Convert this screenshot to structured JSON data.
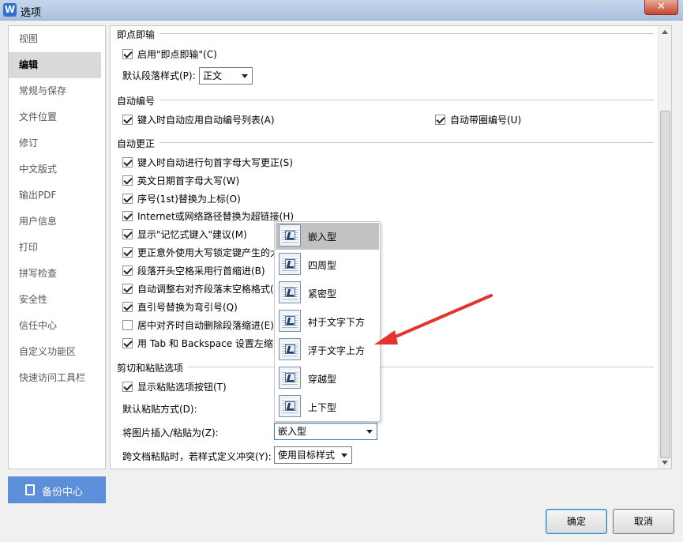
{
  "window": {
    "title": "选项",
    "app_icon": "W",
    "close_label": "✕"
  },
  "sidebar": {
    "items": [
      {
        "label": "视图"
      },
      {
        "label": "编辑"
      },
      {
        "label": "常规与保存"
      },
      {
        "label": "文件位置"
      },
      {
        "label": "修订"
      },
      {
        "label": "中文版式"
      },
      {
        "label": "输出PDF"
      },
      {
        "label": "用户信息"
      },
      {
        "label": "打印"
      },
      {
        "label": "拼写检查"
      },
      {
        "label": "安全性"
      },
      {
        "label": "信任中心"
      },
      {
        "label": "自定义功能区"
      },
      {
        "label": "快速访问工具栏"
      }
    ],
    "active_index": 1,
    "backup_label": "备份中心"
  },
  "sections": {
    "click_input": {
      "title": "即点即输",
      "enable_label": "启用\"即点即输\"(C)",
      "enable_checked": true,
      "default_style_label": "默认段落样式(P):",
      "default_style_value": "正文"
    },
    "auto_number": {
      "title": "自动编号",
      "apply_list_label": "键入时自动应用自动编号列表(A)",
      "apply_list_checked": true,
      "circled_label": "自动带圈编号(U)",
      "circled_checked": true
    },
    "auto_correct": {
      "title": "自动更正",
      "items": [
        {
          "label": "键入时自动进行句首字母大写更正(S)",
          "checked": true
        },
        {
          "label": "英文日期首字母大写(W)",
          "checked": true
        },
        {
          "label": "序号(1st)替换为上标(O)",
          "checked": true
        },
        {
          "label": "Internet或网络路径替换为超链接(H)",
          "checked": true
        },
        {
          "label": "显示\"记忆式键入\"建议(M)",
          "checked": true
        },
        {
          "label": "更正意外使用大写锁定键产生的大",
          "checked": true
        },
        {
          "label": "段落开头空格采用行首缩进(B)",
          "checked": true
        },
        {
          "label": "自动调整右对齐段落末空格格式(",
          "checked": true
        },
        {
          "label": "直引号替换为弯引号(Q)",
          "checked": true
        },
        {
          "label": "居中对齐时自动删除段落缩进(E)",
          "checked": false
        },
        {
          "label": "用 Tab 和 Backspace 设置左缩",
          "checked": true
        }
      ]
    },
    "paste": {
      "title": "剪切和粘贴选项",
      "show_button_label": "显示粘贴选项按钮(T)",
      "show_button_checked": true,
      "default_paste_label": "默认粘贴方式(D):",
      "picture_label": "将图片插入/粘贴为(Z):",
      "picture_value": "嵌入型",
      "cross_doc_label": "跨文档粘贴时，若样式定义冲突(Y):",
      "cross_doc_value": "使用目标样式"
    }
  },
  "dropdown": {
    "options": [
      {
        "label": "嵌入型",
        "icon": "wrap-inline-icon"
      },
      {
        "label": "四周型",
        "icon": "wrap-square-icon"
      },
      {
        "label": "紧密型",
        "icon": "wrap-tight-icon"
      },
      {
        "label": "衬于文字下方",
        "icon": "wrap-behind-text-icon"
      },
      {
        "label": "浮于文字上方",
        "icon": "wrap-in-front-icon"
      },
      {
        "label": "穿越型",
        "icon": "wrap-through-icon"
      },
      {
        "label": "上下型",
        "icon": "wrap-top-bottom-icon"
      }
    ],
    "selected_index": 0
  },
  "buttons": {
    "ok_label": "确定",
    "cancel_label": "取消"
  },
  "colors": {
    "accent": "#5c8ed9",
    "annotation_arrow": "#e5322d"
  }
}
